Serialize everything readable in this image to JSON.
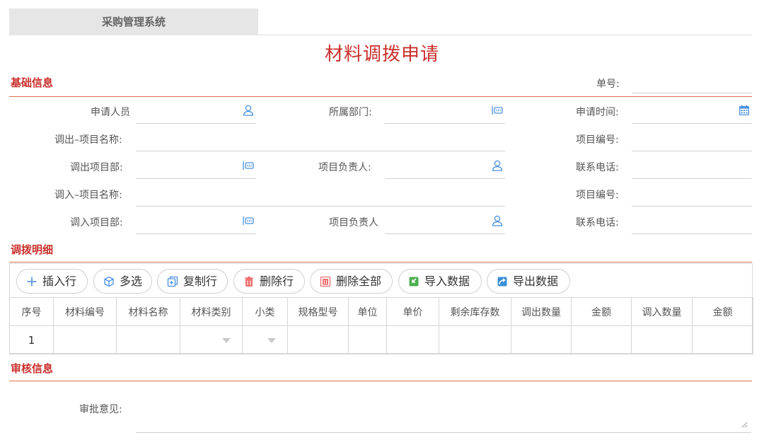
{
  "app": {
    "tab_label": "采购管理系统"
  },
  "page": {
    "title": "材料调拨申请"
  },
  "basic": {
    "section_title": "基础信息",
    "order_no_label": "单号:",
    "applicant_label": "申请人员",
    "department_label": "所属部门:",
    "apply_time_label": "申请时间:",
    "out_project_name_label": "调出–项目名称:",
    "out_project_no_label": "项目编号:",
    "out_project_dept_label": "调出项目部:",
    "out_manager_label": "项目负责人:",
    "out_phone_label": "联系电话:",
    "in_project_name_label": "调入–项目名称:",
    "in_project_no_label": "项目编号:",
    "in_project_dept_label": "调入项目部:",
    "in_manager_label": "项目负责人",
    "in_phone_label": "联系电话:"
  },
  "detail": {
    "section_title": "调拨明细",
    "buttons": [
      {
        "label": "插入行",
        "icon": "plus-icon"
      },
      {
        "label": "多选",
        "icon": "cube-icon"
      },
      {
        "label": "复制行",
        "icon": "copy-icon"
      },
      {
        "label": "删除行",
        "icon": "trash-icon"
      },
      {
        "label": "删除全部",
        "icon": "trash-all-icon"
      },
      {
        "label": "导入数据",
        "icon": "import-icon"
      },
      {
        "label": "导出数据",
        "icon": "export-icon"
      }
    ],
    "columns": [
      "序号",
      "材料编号",
      "材料名称",
      "材料类别",
      "小类",
      "规格型号",
      "单位",
      "单价",
      "剩余库存数",
      "调出数量",
      "金额",
      "调入数量",
      "金额"
    ],
    "rows": [
      {
        "index": "1"
      }
    ]
  },
  "audit": {
    "section_title": "审核信息",
    "opinion_label": "审批意见:"
  },
  "colors": {
    "accent": "#c9302c",
    "icon_blue": "#4a90e2"
  }
}
